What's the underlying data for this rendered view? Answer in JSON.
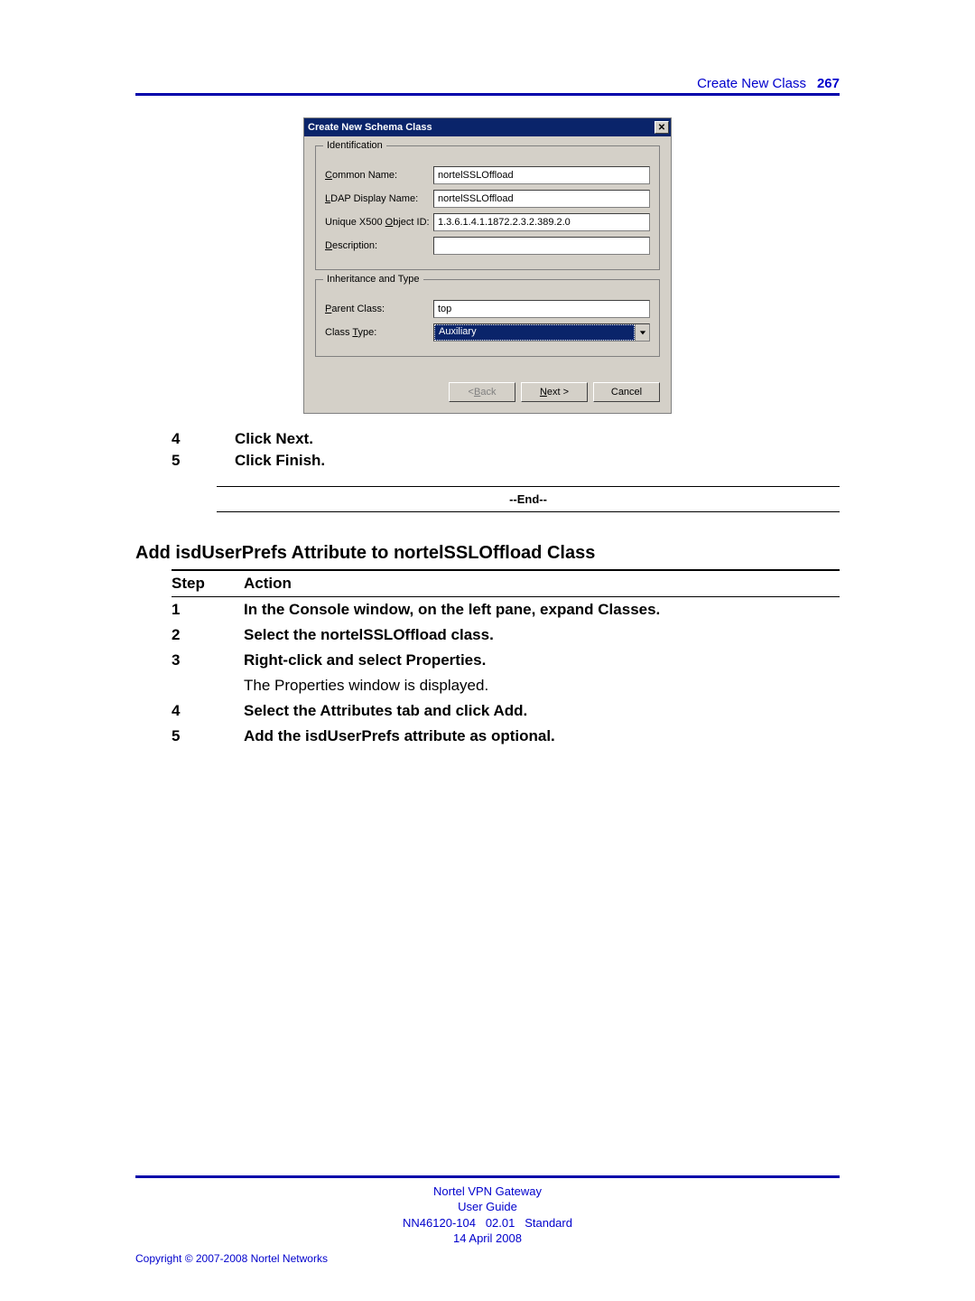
{
  "header": {
    "title": "Create New Class",
    "page_number": "267"
  },
  "dialog": {
    "title": "Create New Schema Class",
    "group1_legend": "Identification",
    "common_name_label_pre": "C",
    "common_name_label_post": "ommon Name:",
    "common_name_value": "nortelSSLOffload",
    "ldap_label_pre": "L",
    "ldap_label_post": "DAP Display Name:",
    "ldap_value": "nortelSSLOffload",
    "oid_label_pre": "Unique X500 ",
    "oid_label_ul": "O",
    "oid_label_post": "bject ID:",
    "oid_value": "1.3.6.1.4.1.1872.2.3.2.389.2.0",
    "desc_label_pre": "D",
    "desc_label_post": "escription:",
    "desc_value": "",
    "group2_legend": "Inheritance and Type",
    "parent_label_pre": "P",
    "parent_label_post": "arent Class:",
    "parent_value": "top",
    "type_label_pre": "Class ",
    "type_label_ul": "T",
    "type_label_post": "ype:",
    "type_value": "Auxiliary",
    "back_pre": "< ",
    "back_ul": "B",
    "back_post": "ack",
    "next_ul": "N",
    "next_post": "ext >",
    "cancel": "Cancel"
  },
  "steps_upper": [
    {
      "n": "4",
      "text": "Click Next."
    },
    {
      "n": "5",
      "text": "Click Finish."
    }
  ],
  "end_label": "--End--",
  "section_title": "Add isdUserPrefs Attribute to nortelSSLOffload Class",
  "table": {
    "head_step": "Step",
    "head_action": "Action",
    "rows": [
      {
        "n": "1",
        "text": "In the Console window, on the left pane, expand Classes.",
        "bold": true
      },
      {
        "n": "2",
        "text": "Select the nortelSSLOffload class.",
        "bold": true
      },
      {
        "n": "3",
        "text": "Right-click and select Properties.",
        "bold": true
      },
      {
        "n": "",
        "text": "The Properties window is displayed.",
        "bold": false
      },
      {
        "n": "4",
        "text": "Select the Attributes tab and click Add.",
        "bold": true
      },
      {
        "n": "5",
        "text": "Add the isdUserPrefs attribute as optional.",
        "bold": true
      }
    ]
  },
  "footer": {
    "line1": "Nortel VPN Gateway",
    "line2": "User Guide",
    "line3a": "NN46120-104",
    "line3b": "02.01",
    "line3c": "Standard",
    "line4": "14 April 2008",
    "copyright": "Copyright © 2007-2008 Nortel Networks"
  }
}
